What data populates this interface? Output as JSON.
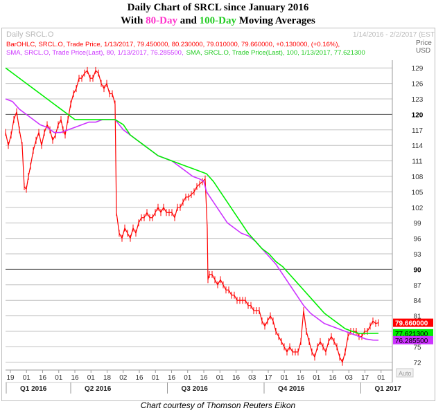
{
  "title_line1": "Daily Chart of SRCL since January 2016",
  "title_line2": {
    "prefix": "With ",
    "day80": "80-Day",
    "mid": " and ",
    "day100": "100-Day",
    "suffix": " Moving Averages"
  },
  "header": {
    "instrument": "Daily SRCL.O",
    "date_range": "1/14/2016 - 2/2/2017 (EST)",
    "price_label": "Price",
    "currency_label": "USD"
  },
  "legend": {
    "ohlc": "BarOHLC, SRCL.O, Trade Price, 1/13/2017, 79.450000, 80.230000, 79.010000, 79.660000, +0.130000, (+0.16%),",
    "sma80": "SMA, SRCL.O, Trade Price(Last), 80, 1/13/2017, 76.285500,",
    "sma100": "SMA, SRCL.O, Trade Price(Last), 100, 1/13/2017, 77.621300"
  },
  "auto_label": "Auto",
  "caption": "Chart courtesy of Thomson Reuters Eikon",
  "colors": {
    "price": "#ff0000",
    "sma80": "#cc33ff",
    "sma100": "#00ee00"
  },
  "chart_data": {
    "type": "line",
    "ylim": [
      70.5,
      130.5
    ],
    "y_ticks": [
      72,
      75,
      78,
      81,
      84,
      87,
      90,
      93,
      96,
      99,
      102,
      105,
      108,
      111,
      114,
      117,
      120,
      123,
      126,
      129
    ],
    "y_bold_ticks": [
      90,
      120
    ],
    "x_ticks": [
      "19",
      "01",
      "16",
      "01",
      "16",
      "01",
      "18",
      "02",
      "16",
      "01",
      "16",
      "01",
      "16",
      "01",
      "16",
      "03",
      "17",
      "01",
      "16",
      "01",
      "16",
      "03",
      "17",
      "01"
    ],
    "quarters": [
      "Q1 2016",
      "Q2 2016",
      "Q3 2016",
      "Q4 2016",
      "Q1 2017"
    ],
    "last_values": {
      "close": 79.66,
      "sma100": 77.6213,
      "sma80": 76.2855
    },
    "last_value_labels": {
      "close": "79.660000",
      "sma100": "77.621300",
      "sma80": "76.285500"
    },
    "series": [
      {
        "key": "price",
        "values": [
          [
            0,
            116.5
          ],
          [
            4,
            114
          ],
          [
            8,
            116
          ],
          [
            12,
            119
          ],
          [
            16,
            120.5
          ],
          [
            20,
            117
          ],
          [
            24,
            114
          ],
          [
            27,
            106
          ],
          [
            30,
            105.5
          ],
          [
            33,
            108
          ],
          [
            36,
            110
          ],
          [
            40,
            113
          ],
          [
            44,
            115
          ],
          [
            48,
            116.5
          ],
          [
            52,
            114
          ],
          [
            56,
            116.5
          ],
          [
            60,
            118
          ],
          [
            64,
            117
          ],
          [
            68,
            115
          ],
          [
            72,
            116
          ],
          [
            76,
            118
          ],
          [
            80,
            119
          ],
          [
            83,
            117
          ],
          [
            86,
            116
          ],
          [
            90,
            119
          ],
          [
            94,
            122
          ],
          [
            98,
            124
          ],
          [
            102,
            125
          ],
          [
            106,
            127
          ],
          [
            110,
            127
          ],
          [
            114,
            128
          ],
          [
            118,
            128.5
          ],
          [
            122,
            127
          ],
          [
            126,
            127
          ],
          [
            130,
            128.5
          ],
          [
            134,
            128
          ],
          [
            138,
            126
          ],
          [
            142,
            125
          ],
          [
            146,
            126
          ],
          [
            150,
            124
          ],
          [
            154,
            124
          ],
          [
            158,
            122
          ],
          [
            160,
            101
          ],
          [
            164,
            97
          ],
          [
            168,
            96
          ],
          [
            172,
            98
          ],
          [
            176,
            97
          ],
          [
            180,
            96
          ],
          [
            184,
            98
          ],
          [
            188,
            97
          ],
          [
            192,
            99
          ],
          [
            196,
            100
          ],
          [
            200,
            100
          ],
          [
            204,
            101
          ],
          [
            208,
            100
          ],
          [
            212,
            100
          ],
          [
            216,
            101
          ],
          [
            220,
            102
          ],
          [
            224,
            101
          ],
          [
            228,
            102
          ],
          [
            232,
            101
          ],
          [
            236,
            101
          ],
          [
            240,
            101
          ],
          [
            244,
            100
          ],
          [
            248,
            102
          ],
          [
            252,
            102
          ],
          [
            256,
            103
          ],
          [
            260,
            104
          ],
          [
            264,
            104
          ],
          [
            268,
            104.5
          ],
          [
            272,
            105
          ],
          [
            276,
            106
          ],
          [
            280,
            106.5
          ],
          [
            284,
            107
          ],
          [
            288,
            107.5
          ],
          [
            291,
            98
          ],
          [
            292,
            88
          ],
          [
            294,
            89
          ],
          [
            298,
            89
          ],
          [
            302,
            88
          ],
          [
            306,
            87
          ],
          [
            310,
            88
          ],
          [
            314,
            87
          ],
          [
            318,
            86
          ],
          [
            322,
            86
          ],
          [
            326,
            85
          ],
          [
            330,
            85
          ],
          [
            334,
            84
          ],
          [
            338,
            84
          ],
          [
            342,
            84
          ],
          [
            346,
            84
          ],
          [
            350,
            83
          ],
          [
            354,
            83
          ],
          [
            358,
            82
          ],
          [
            362,
            82
          ],
          [
            366,
            82
          ],
          [
            370,
            80
          ],
          [
            374,
            79
          ],
          [
            378,
            80
          ],
          [
            382,
            81
          ],
          [
            386,
            80
          ],
          [
            390,
            78
          ],
          [
            394,
            77
          ],
          [
            398,
            76
          ],
          [
            402,
            75
          ],
          [
            406,
            74
          ],
          [
            410,
            75
          ],
          [
            414,
            74
          ],
          [
            418,
            74
          ],
          [
            422,
            74
          ],
          [
            426,
            76
          ],
          [
            430,
            82
          ],
          [
            434,
            78
          ],
          [
            438,
            76
          ],
          [
            442,
            74
          ],
          [
            446,
            73
          ],
          [
            450,
            75
          ],
          [
            454,
            76
          ],
          [
            458,
            75
          ],
          [
            462,
            74
          ],
          [
            466,
            76
          ],
          [
            470,
            77
          ],
          [
            474,
            76
          ],
          [
            478,
            75
          ],
          [
            482,
            73
          ],
          [
            486,
            72
          ],
          [
            490,
            74
          ],
          [
            494,
            77
          ],
          [
            498,
            78
          ],
          [
            502,
            78
          ],
          [
            506,
            78
          ],
          [
            510,
            77
          ],
          [
            514,
            77
          ],
          [
            518,
            78
          ],
          [
            522,
            78
          ],
          [
            526,
            79
          ],
          [
            530,
            80
          ],
          [
            534,
            79.5
          ],
          [
            538,
            79.66
          ]
        ]
      },
      {
        "key": "sma80",
        "values": [
          [
            0,
            123
          ],
          [
            10,
            122.5
          ],
          [
            20,
            121
          ],
          [
            30,
            120
          ],
          [
            40,
            119
          ],
          [
            50,
            118
          ],
          [
            60,
            117.5
          ],
          [
            70,
            116.5
          ],
          [
            80,
            116.5
          ],
          [
            90,
            117
          ],
          [
            100,
            117.5
          ],
          [
            110,
            118
          ],
          [
            120,
            118.5
          ],
          [
            130,
            118.5
          ],
          [
            140,
            119
          ],
          [
            150,
            119
          ],
          [
            158,
            119
          ],
          [
            170,
            117
          ],
          [
            180,
            116
          ],
          [
            190,
            115
          ],
          [
            200,
            114
          ],
          [
            210,
            113
          ],
          [
            220,
            112
          ],
          [
            230,
            111.5
          ],
          [
            240,
            111
          ],
          [
            250,
            110
          ],
          [
            260,
            109
          ],
          [
            270,
            108
          ],
          [
            280,
            107.5
          ],
          [
            286,
            107
          ],
          [
            290,
            105
          ],
          [
            300,
            103
          ],
          [
            310,
            101
          ],
          [
            320,
            99
          ],
          [
            330,
            98
          ],
          [
            340,
            97
          ],
          [
            350,
            96.5
          ],
          [
            360,
            95.5
          ],
          [
            370,
            94
          ],
          [
            380,
            92.5
          ],
          [
            390,
            91
          ],
          [
            400,
            89
          ],
          [
            410,
            87
          ],
          [
            420,
            85
          ],
          [
            430,
            83
          ],
          [
            440,
            81.5
          ],
          [
            450,
            80.5
          ],
          [
            460,
            79.5
          ],
          [
            470,
            79
          ],
          [
            480,
            78.5
          ],
          [
            490,
            78
          ],
          [
            500,
            77.5
          ],
          [
            510,
            77
          ],
          [
            520,
            76.5
          ],
          [
            530,
            76.3
          ],
          [
            538,
            76.2855
          ]
        ]
      },
      {
        "key": "sma100",
        "values": [
          [
            0,
            129
          ],
          [
            10,
            128
          ],
          [
            20,
            127
          ],
          [
            30,
            126
          ],
          [
            40,
            125
          ],
          [
            50,
            124
          ],
          [
            60,
            123
          ],
          [
            70,
            122
          ],
          [
            80,
            121
          ],
          [
            90,
            120
          ],
          [
            100,
            119
          ],
          [
            110,
            119
          ],
          [
            120,
            119
          ],
          [
            130,
            119
          ],
          [
            140,
            119
          ],
          [
            150,
            119
          ],
          [
            158,
            119
          ],
          [
            170,
            118
          ],
          [
            180,
            116
          ],
          [
            190,
            115
          ],
          [
            200,
            114
          ],
          [
            210,
            113
          ],
          [
            220,
            112
          ],
          [
            230,
            111.5
          ],
          [
            240,
            111
          ],
          [
            250,
            110.5
          ],
          [
            260,
            110
          ],
          [
            270,
            109.5
          ],
          [
            280,
            109
          ],
          [
            290,
            108.5
          ],
          [
            300,
            107
          ],
          [
            310,
            105
          ],
          [
            320,
            103
          ],
          [
            330,
            101
          ],
          [
            340,
            99
          ],
          [
            350,
            97
          ],
          [
            360,
            95.5
          ],
          [
            370,
            94
          ],
          [
            380,
            93
          ],
          [
            390,
            91.5
          ],
          [
            400,
            90.5
          ],
          [
            410,
            89
          ],
          [
            420,
            87.5
          ],
          [
            430,
            86
          ],
          [
            440,
            84.5
          ],
          [
            450,
            83
          ],
          [
            460,
            81.5
          ],
          [
            470,
            80.5
          ],
          [
            480,
            79.5
          ],
          [
            490,
            78.5
          ],
          [
            500,
            78
          ],
          [
            510,
            77.6
          ],
          [
            520,
            77.6
          ],
          [
            530,
            77.6
          ],
          [
            538,
            77.6213
          ]
        ]
      }
    ]
  }
}
